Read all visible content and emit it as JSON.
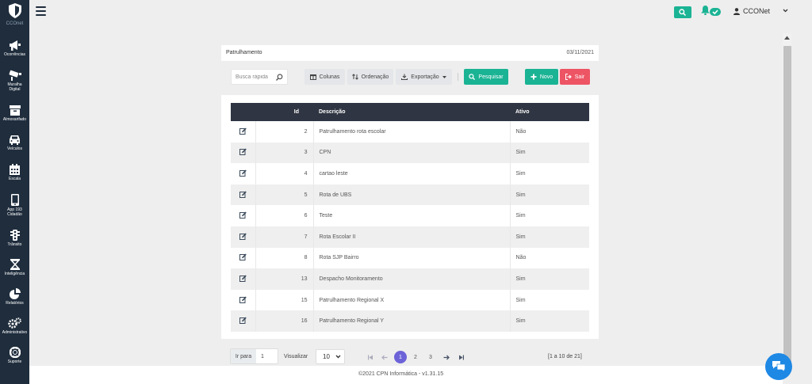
{
  "sidebar": {
    "brand_label": "CCOnet",
    "items": [
      {
        "label": "Ocorrências",
        "icon": "megaphone-icon"
      },
      {
        "label": "Muralha Digital",
        "icon": "camera-icon"
      },
      {
        "label": "Almoxarifado",
        "icon": "archive-icon"
      },
      {
        "label": "Veículos",
        "icon": "car-icon"
      },
      {
        "label": "Escala",
        "icon": "calendar-icon"
      },
      {
        "label": "App 193 Cidadão",
        "icon": "mobile-icon"
      },
      {
        "label": "Trânsito",
        "icon": "traffic-light-icon"
      },
      {
        "label": "Inteligência",
        "icon": "hourglass-icon"
      },
      {
        "label": "Relatórios",
        "icon": "pie-chart-icon"
      },
      {
        "label": "Administrativo",
        "icon": "cogs-icon"
      },
      {
        "label": "Suporte",
        "icon": "lifebuoy-icon"
      }
    ]
  },
  "topbar": {
    "user_name": "CCONet"
  },
  "panel": {
    "title": "Patrulhamento",
    "date": "03/11/2021"
  },
  "toolbar": {
    "search_placeholder": "Busca rápida",
    "columns_label": "Colunas",
    "sort_label": "Ordenação",
    "export_label": "Exportação",
    "search_button": "Pesquisar",
    "new_button": "Novo",
    "exit_button": "Sair"
  },
  "table": {
    "headers": {
      "id": "Id",
      "description": "Descrição",
      "active": "Ativo"
    },
    "rows": [
      {
        "id": "2",
        "description": "Patrulhamento rota escolar",
        "active": "Não"
      },
      {
        "id": "3",
        "description": "CPN",
        "active": "Sim"
      },
      {
        "id": "4",
        "description": "cartao leste",
        "active": "Sim"
      },
      {
        "id": "5",
        "description": "Rota de UBS",
        "active": "Sim"
      },
      {
        "id": "6",
        "description": "Teste",
        "active": "Sim"
      },
      {
        "id": "7",
        "description": "Rota Escolar II",
        "active": "Sim"
      },
      {
        "id": "8",
        "description": "Rota SJP Bairro",
        "active": "Não"
      },
      {
        "id": "13",
        "description": "Despacho Monitoramento",
        "active": "Sim"
      },
      {
        "id": "15",
        "description": "Patrulhamento Regional X",
        "active": "Sim"
      },
      {
        "id": "16",
        "description": "Patrulhamento Regional Y",
        "active": "Sim"
      }
    ]
  },
  "pagination": {
    "goto_label": "Ir para",
    "goto_value": "1",
    "view_label": "Visualizar",
    "page_size": "10",
    "pages": [
      "1",
      "2",
      "3"
    ],
    "current_page": "1",
    "range_text": "[1 a 10 de 21]"
  },
  "footer": {
    "text": "©2021 CPN Informática - v1.31.15"
  },
  "colors": {
    "sidebar_bg": "#1f2d3d",
    "primary_green": "#1ab394",
    "danger_red": "#ed5565",
    "table_header": "#2f3542",
    "active_page": "#6c63d8",
    "chat_blue": "#1e88e5"
  }
}
